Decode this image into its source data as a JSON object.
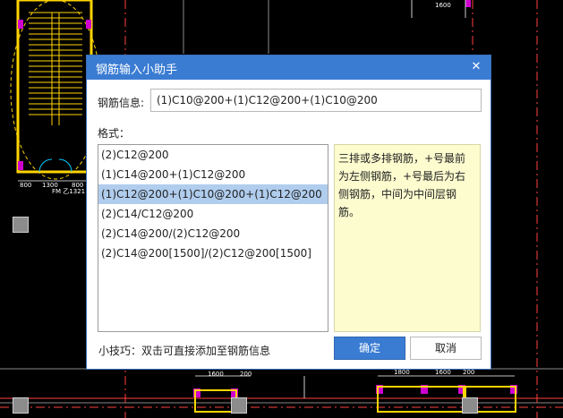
{
  "cad": {
    "dim_labels": [
      "1600",
      "200",
      "800",
      "1300",
      "800",
      "FM 乙1321",
      "1600",
      "200",
      "1800",
      "1600",
      "200"
    ]
  },
  "dialog": {
    "title": "钢筋输入小助手",
    "close_icon": "close-icon",
    "info_label": "钢筋信息:",
    "info_value": "(1)C10@200+(1)C12@200+(1)C10@200",
    "format_label": "格式：",
    "formats": [
      "(2)C12@200",
      "(1)C14@200+(1)C12@200",
      "(1)C12@200+(1)C10@200+(1)C12@200",
      "(2)C14/C12@200",
      "(2)C14@200/(2)C12@200",
      "(2)C14@200[1500]/(2)C12@200[1500]"
    ],
    "selected_index": 2,
    "hint": "三排或多排钢筋，+号最前为左侧钢筋，+号最后为右侧钢筋，中间为中间层钢筋。",
    "tip": "小技巧：双击可直接添加至钢筋信息",
    "ok_label": "确定",
    "cancel_label": "取消",
    "accent_color": "#3b7cd3",
    "selection_color": "#b0cdee",
    "hint_bg_color": "#fdfccf"
  }
}
